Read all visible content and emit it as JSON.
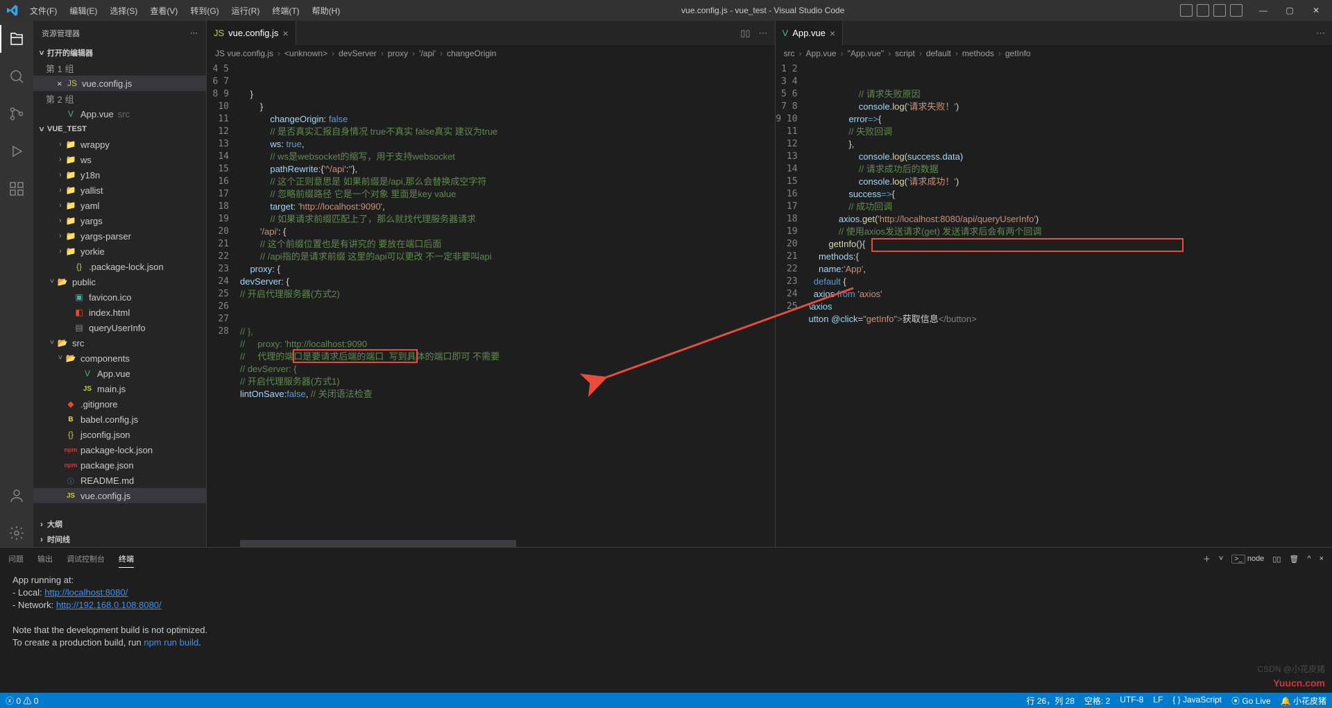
{
  "window": {
    "title": "vue.config.js - vue_test - Visual Studio Code",
    "menus": [
      "文件(F)",
      "编辑(E)",
      "选择(S)",
      "查看(V)",
      "转到(G)",
      "运行(R)",
      "终端(T)",
      "帮助(H)"
    ]
  },
  "sidebar": {
    "title": "资源管理器",
    "sections": {
      "openEditors": "打开的编辑器",
      "group1": "第 1 组",
      "group2": "第 2 组",
      "project": "VUE_TEST",
      "outline": "大纲",
      "timeline": "时间线"
    },
    "openEditorItems": [
      {
        "icon": "js",
        "label": "vue.config.js",
        "close": true,
        "active": true,
        "indent": 30
      },
      {
        "icon": "vue",
        "label": "App.vue",
        "meta": "src",
        "indent": 42
      }
    ],
    "tree": [
      {
        "chev": ">",
        "indent": 18,
        "icon": "folder",
        "label": "wrappy"
      },
      {
        "chev": ">",
        "indent": 18,
        "icon": "folder",
        "label": "ws"
      },
      {
        "chev": ">",
        "indent": 18,
        "icon": "folder",
        "label": "y18n"
      },
      {
        "chev": ">",
        "indent": 18,
        "icon": "folder",
        "label": "yallist"
      },
      {
        "chev": ">",
        "indent": 18,
        "icon": "folder",
        "label": "yaml"
      },
      {
        "chev": ">",
        "indent": 18,
        "icon": "folder",
        "label": "yargs"
      },
      {
        "chev": ">",
        "indent": 18,
        "icon": "folder",
        "label": "yargs-parser"
      },
      {
        "chev": ">",
        "indent": 18,
        "icon": "folder",
        "label": "yorkie"
      },
      {
        "chev": "",
        "indent": 30,
        "icon": "json",
        "label": ".package-lock.json"
      },
      {
        "chev": "v",
        "indent": 6,
        "icon": "folder-open",
        "label": "public"
      },
      {
        "chev": "",
        "indent": 30,
        "icon": "ico",
        "label": "favicon.ico"
      },
      {
        "chev": "",
        "indent": 30,
        "icon": "html",
        "label": "index.html"
      },
      {
        "chev": "",
        "indent": 30,
        "icon": "file",
        "label": "queryUserInfo"
      },
      {
        "chev": "v",
        "indent": 6,
        "icon": "folder-open",
        "label": "src"
      },
      {
        "chev": "v",
        "indent": 18,
        "icon": "folder-open",
        "label": "components"
      },
      {
        "chev": "",
        "indent": 42,
        "icon": "vue",
        "label": "App.vue"
      },
      {
        "chev": "",
        "indent": 42,
        "icon": "js",
        "label": "main.js"
      },
      {
        "chev": "",
        "indent": 18,
        "icon": "git",
        "label": ".gitignore"
      },
      {
        "chev": "",
        "indent": 18,
        "icon": "babel",
        "label": "babel.config.js"
      },
      {
        "chev": "",
        "indent": 18,
        "icon": "json",
        "label": "jsconfig.json"
      },
      {
        "chev": "",
        "indent": 18,
        "icon": "npm",
        "label": "package-lock.json"
      },
      {
        "chev": "",
        "indent": 18,
        "icon": "npm",
        "label": "package.json"
      },
      {
        "chev": "",
        "indent": 18,
        "icon": "md",
        "label": "README.md"
      },
      {
        "chev": "",
        "indent": 18,
        "icon": "js",
        "label": "vue.config.js",
        "active": true
      }
    ]
  },
  "editorLeft": {
    "tab": "vue.config.js",
    "breadcrumb": [
      "vue.config.js",
      "<unknown>",
      "devServer",
      "proxy",
      "'/api'",
      "changeOrigin"
    ],
    "startLine": 4,
    "lines": [
      [
        [
          "c-prop",
          "lintOnSave"
        ],
        [
          "c-punc",
          ":"
        ],
        [
          "c-kw",
          "false"
        ],
        [
          "c-punc",
          ", "
        ],
        [
          "c-comment",
          "// 关闭语法检查"
        ]
      ],
      [
        [
          "c-comment",
          "// 开启代理服务器(方式1)"
        ]
      ],
      [
        [
          "c-comment",
          "// devServer: {"
        ]
      ],
      [
        [
          "c-comment",
          "//     代理的端口是要请求后端的端口  写到具体的端口即可 不需要"
        ]
      ],
      [
        [
          "c-comment",
          "//     proxy: 'http://localhost:9090"
        ]
      ],
      [
        [
          "c-comment",
          "// },"
        ]
      ],
      [
        [
          "",
          "  "
        ]
      ],
      [
        [
          "",
          "  "
        ]
      ],
      [
        [
          "c-comment",
          "// 开启代理服务器(方式2)"
        ]
      ],
      [
        [
          "c-prop",
          "devServer"
        ],
        [
          "c-punc",
          ": {"
        ]
      ],
      [
        [
          "c-prop",
          "    proxy"
        ],
        [
          "c-punc",
          ": {"
        ]
      ],
      [
        [
          "c-comment",
          "        // /api指的是请求前缀 这里的api可以更改 不一定非要叫api"
        ]
      ],
      [
        [
          "c-comment",
          "        // 这个前缀位置也是有讲究的 要放在端口后面"
        ]
      ],
      [
        [
          "c-str",
          "        '/api'"
        ],
        [
          "c-punc",
          ": {"
        ]
      ],
      [
        [
          "c-comment",
          "            // 如果请求前缀匹配上了，那么就找代理服务器请求"
        ]
      ],
      [
        [
          "c-prop",
          "            target"
        ],
        [
          "c-punc",
          ": "
        ],
        [
          "c-str",
          "'http://localhost:9090'"
        ],
        [
          "c-punc",
          ","
        ]
      ],
      [
        [
          "c-comment",
          "            // 忽略前缀路径 它是一个对象 里面是key value"
        ]
      ],
      [
        [
          "c-comment",
          "            // 这个正则意思是 如果前缀是/api,那么会替换成空字符"
        ]
      ],
      [
        [
          "c-prop",
          "            pathRewrite"
        ],
        [
          "c-punc",
          ":{"
        ],
        [
          "c-str",
          "'^/api'"
        ],
        [
          "c-punc",
          ":"
        ],
        [
          "c-str",
          "''"
        ],
        [
          "c-punc",
          "},"
        ]
      ],
      [
        [
          "c-comment",
          "            // ws是websocket的缩写，用于支持websocket"
        ]
      ],
      [
        [
          "c-prop",
          "            ws"
        ],
        [
          "c-punc",
          ": "
        ],
        [
          "c-kw",
          "true"
        ],
        [
          "c-punc",
          ","
        ]
      ],
      [
        [
          "c-comment",
          "            // 是否真实汇报自身情况 true不真实 false真实 建议为true"
        ]
      ],
      [
        [
          "c-prop",
          "            changeOrigin"
        ],
        [
          "c-punc",
          ": "
        ],
        [
          "c-kw",
          "false"
        ]
      ],
      [
        [
          "c-punc",
          "        }"
        ]
      ],
      [
        [
          "c-punc",
          "    }"
        ]
      ]
    ]
  },
  "editorRight": {
    "tab": "App.vue",
    "breadcrumb": [
      "src",
      "App.vue",
      "\"App.vue\"",
      "script",
      "default",
      "methods",
      "getInfo"
    ],
    "startLine": 1,
    "lines": [
      [
        [
          "",
          ""
        ]
      ],
      [
        [
          "c-prop",
          "utton "
        ],
        [
          "c-prop",
          "@click"
        ],
        [
          "c-punc",
          "="
        ],
        [
          "c-str",
          "\"getInfo\""
        ],
        [
          "c-tag",
          ">"
        ],
        [
          "",
          "获取信息"
        ],
        [
          "c-tag",
          "</button>"
        ]
      ],
      [
        [
          "",
          ""
        ]
      ],
      [
        [
          "",
          ""
        ]
      ],
      [
        [
          "",
          ""
        ]
      ],
      [
        [
          "",
          ""
        ]
      ],
      [
        [
          "",
          ""
        ]
      ],
      [
        [
          "c-prop",
          "\\axios"
        ]
      ],
      [
        [
          "c-prop",
          "  axios "
        ],
        [
          "c-kw",
          "from "
        ],
        [
          "c-str",
          "'axios'"
        ]
      ],
      [
        [
          "c-kw",
          "  default "
        ],
        [
          "c-punc",
          "{"
        ]
      ],
      [
        [
          "c-prop",
          "    name"
        ],
        [
          "c-punc",
          ":"
        ],
        [
          "c-str",
          "'App'"
        ],
        [
          "c-punc",
          ","
        ]
      ],
      [
        [
          "c-prop",
          "    methods"
        ],
        [
          "c-punc",
          ":{"
        ]
      ],
      [
        [
          "c-fn",
          "        getInfo"
        ],
        [
          "c-punc",
          "(){"
        ]
      ],
      [
        [
          "c-comment",
          "            // 使用axios发送请求(get) 发送请求后会有两个回调"
        ]
      ],
      [
        [
          "c-prop",
          "            axios"
        ],
        [
          "c-punc",
          "."
        ],
        [
          "c-fn",
          "get"
        ],
        [
          "c-punc",
          "("
        ],
        [
          "c-str",
          "'http://localhost:8080/api/queryUserInfo'"
        ],
        [
          "c-punc",
          ")"
        ]
      ],
      [
        [
          "c-comment",
          "                // 成功回调"
        ]
      ],
      [
        [
          "c-prop",
          "                success"
        ],
        [
          "c-kw",
          "=>"
        ],
        [
          "c-punc",
          "{"
        ]
      ],
      [
        [
          "c-prop",
          "                    console"
        ],
        [
          "c-punc",
          "."
        ],
        [
          "c-fn",
          "log"
        ],
        [
          "c-punc",
          "("
        ],
        [
          "c-str",
          "'请求成功！'"
        ],
        [
          "c-punc",
          ")"
        ]
      ],
      [
        [
          "c-comment",
          "                    // 请求成功后的数据"
        ]
      ],
      [
        [
          "c-prop",
          "                    console"
        ],
        [
          "c-punc",
          "."
        ],
        [
          "c-fn",
          "log"
        ],
        [
          "c-punc",
          "("
        ],
        [
          "c-prop",
          "success"
        ],
        [
          "c-punc",
          "."
        ],
        [
          "c-prop",
          "data"
        ],
        [
          "c-punc",
          ")"
        ]
      ],
      [
        [
          "c-punc",
          "                },"
        ]
      ],
      [
        [
          "c-comment",
          "                // 失败回调"
        ]
      ],
      [
        [
          "c-prop",
          "                error"
        ],
        [
          "c-kw",
          "=>"
        ],
        [
          "c-punc",
          "{"
        ]
      ],
      [
        [
          "c-prop",
          "                    console"
        ],
        [
          "c-punc",
          "."
        ],
        [
          "c-fn",
          "log"
        ],
        [
          "c-punc",
          "("
        ],
        [
          "c-str",
          "'请求失败！'"
        ],
        [
          "c-punc",
          ")"
        ]
      ],
      [
        [
          "c-comment",
          "                    // 请求失败原因"
        ]
      ]
    ]
  },
  "panel": {
    "tabs": [
      "问题",
      "输出",
      "调试控制台",
      "终端"
    ],
    "active": 3,
    "shell": "node",
    "terminal": {
      "l1": "App running at:",
      "l2a": "- Local:   ",
      "l2b": "http://localhost:8080/",
      "l3a": "- Network: ",
      "l3b": "http://192.168.0.108:8080/",
      "l4": "Note that the development build is not optimized.",
      "l5a": "To create a production build, run ",
      "l5b": "npm run build",
      "l5c": "."
    }
  },
  "status": {
    "errors": "0",
    "warnings": "0",
    "lncol": "行 26，列 28",
    "spaces": "空格: 2",
    "encoding": "UTF-8",
    "eol": "LF",
    "lang": "{ } JavaScript",
    "golive": "⦿ Go Live",
    "notif": "小花皮猪"
  },
  "watermark": "Yuucn.com",
  "csdn": "CSDN @小花皮猪"
}
